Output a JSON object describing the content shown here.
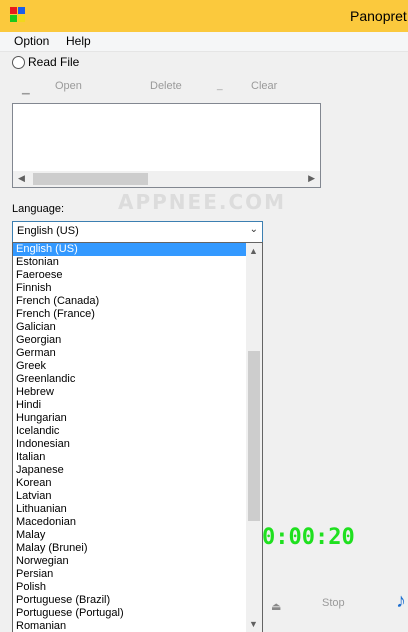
{
  "window": {
    "title": "Panopret"
  },
  "menu": [
    {
      "label": "Option"
    },
    {
      "label": "Help"
    }
  ],
  "read_file": {
    "label": "Read File"
  },
  "toolbar": {
    "open_label": "Open",
    "delete_label": "Delete",
    "clear_label": "Clear"
  },
  "watermark": "APPNEE.COM",
  "language": {
    "label": "Language:",
    "selected": "English (US)",
    "options": [
      "English (US)",
      "Estonian",
      "Faeroese",
      "Finnish",
      "French (Canada)",
      "French (France)",
      "Galician",
      "Georgian",
      "German",
      "Greek",
      "Greenlandic",
      "Hebrew",
      "Hindi",
      "Hungarian",
      "Icelandic",
      "Indonesian",
      "Italian",
      "Japanese",
      "Korean",
      "Latvian",
      "Lithuanian",
      "Macedonian",
      "Malay",
      "Malay (Brunei)",
      "Norwegian",
      "Persian",
      "Polish",
      "Portuguese (Brazil)",
      "Portuguese (Portugal)",
      "Romanian"
    ]
  },
  "timer": {
    "value": "0:00:20"
  },
  "controls": {
    "stop_label": "Stop"
  },
  "colors": {
    "titlebar": "#fbc93d",
    "selection": "#3399ff",
    "timer": "#1fe01f"
  },
  "icons": [
    "app-logo-icon",
    "open-icon",
    "clear-icon",
    "stop-icon",
    "music-note-icon"
  ]
}
